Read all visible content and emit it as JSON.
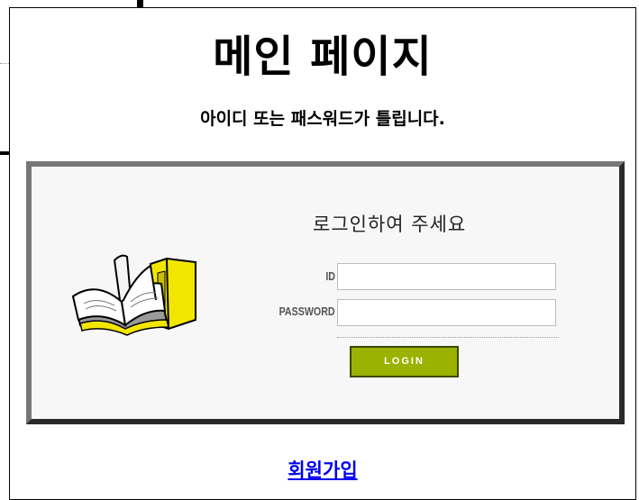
{
  "page": {
    "title": "메인 페이지",
    "error_message": "아이디 또는 패스워드가 틀립니다."
  },
  "login": {
    "heading": "로그인하여 주세요",
    "id_label": "ID",
    "password_label": "PASSWORD",
    "id_value": "",
    "password_value": "",
    "button_label": "LOGIN"
  },
  "signup": {
    "link_text": "회원가입"
  },
  "colors": {
    "button": "#9ab300",
    "link": "#0000ee",
    "book_yellow": "#f2e600"
  },
  "icons": {
    "illustration": "open-book-icon"
  }
}
